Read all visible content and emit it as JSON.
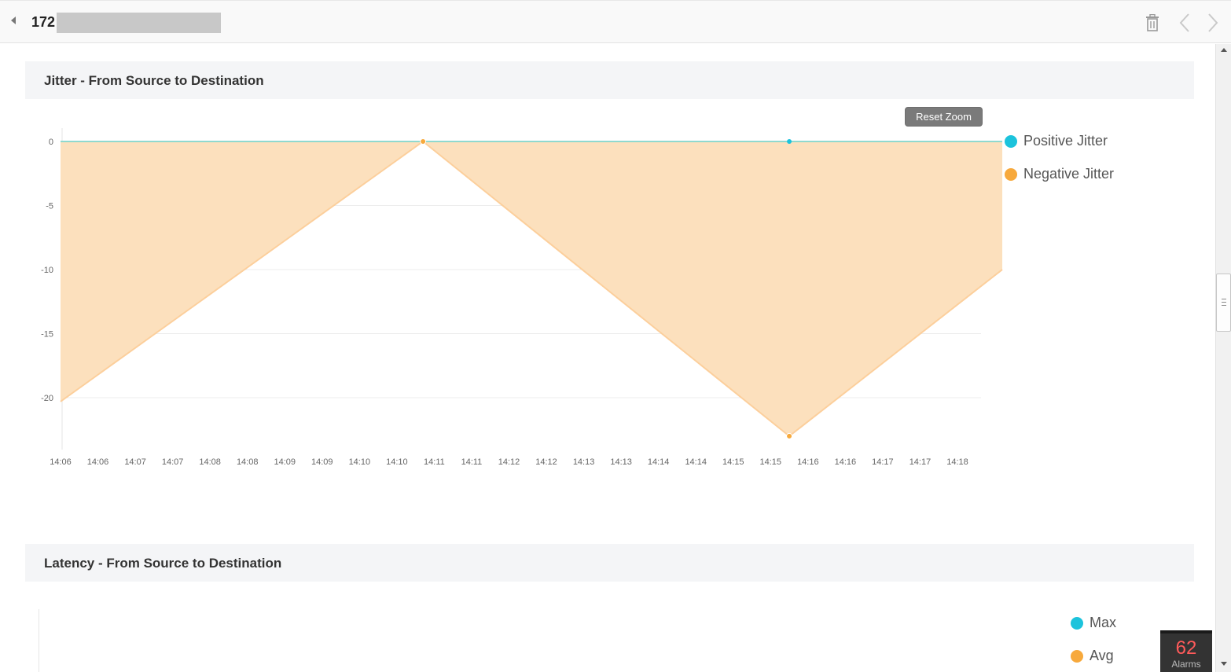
{
  "header": {
    "title_prefix": "172",
    "delete_icon": "trash-icon",
    "prev_icon": "chevron-left-icon",
    "next_icon": "chevron-right-icon"
  },
  "jitter_section": {
    "title": "Jitter - From Source to Destination",
    "reset_zoom_label": "Reset Zoom"
  },
  "latency_section": {
    "title": "Latency - From Source to Destination"
  },
  "alarms": {
    "count": "62",
    "label": "Alarms"
  },
  "colors": {
    "positive": "#1cc3dc",
    "negative": "#f7a93c",
    "negative_fill": "#fce0bd",
    "negative_line": "#fccf9c",
    "positive_line": "#8fd9cf"
  },
  "chart_data": [
    {
      "type": "area",
      "title": "Jitter - From Source to Destination",
      "x_ticks": [
        "14:06",
        "14:06",
        "14:07",
        "14:07",
        "14:08",
        "14:08",
        "14:09",
        "14:09",
        "14:10",
        "14:10",
        "14:11",
        "14:11",
        "14:12",
        "14:12",
        "14:13",
        "14:13",
        "14:14",
        "14:14",
        "14:15",
        "14:15",
        "14:16",
        "14:16",
        "14:17",
        "14:17",
        "14:18"
      ],
      "y_ticks": [
        0,
        -5,
        -10,
        -15,
        -20
      ],
      "ylim": [
        -24.2,
        1
      ],
      "legend": "right",
      "grid": true,
      "series": [
        {
          "name": "Positive Jitter",
          "points": [
            {
              "x": 0,
              "y": 0
            },
            {
              "x": 9.7,
              "y": 0
            },
            {
              "x": 19.5,
              "y": 0
            },
            {
              "x": 25.2,
              "y": 0
            }
          ],
          "markers": [
            19.5
          ]
        },
        {
          "name": "Negative Jitter",
          "points": [
            {
              "x": 0,
              "y": -20.3
            },
            {
              "x": 9.7,
              "y": 0
            },
            {
              "x": 19.5,
              "y": -23
            },
            {
              "x": 25.2,
              "y": -10
            }
          ],
          "markers": [
            9.7,
            19.5
          ]
        }
      ]
    },
    {
      "type": "line",
      "title": "Latency - From Source to Destination",
      "legend": "right",
      "series": [
        {
          "name": "Max",
          "points": []
        },
        {
          "name": "Avg",
          "points": []
        }
      ]
    }
  ]
}
